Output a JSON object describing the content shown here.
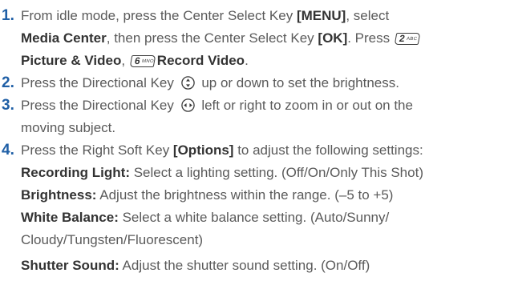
{
  "steps": [
    {
      "number": "1.",
      "lines": [
        {
          "a": "From idle mode, press the Center Select Key ",
          "b": "[MENU]",
          "c": ", select"
        },
        {
          "b1": "Media Center",
          "a": ", then press the Center Select Key ",
          "b2": "[OK]",
          "c": ". Press"
        },
        {
          "b1": "Picture & Video",
          "c": ", ",
          "b2": "Record Video",
          "tail": "."
        }
      ],
      "keys": [
        {
          "digit": "2",
          "letters": "ABC",
          "icon": "key-2-abc-icon"
        },
        {
          "digit": "6",
          "letters": "MNO",
          "icon": "key-6-mno-icon"
        }
      ]
    },
    {
      "number": "2.",
      "a": "Press the Directional Key ",
      "c": " up or down to set the brightness.",
      "icon": "up-down-directional-key-icon"
    },
    {
      "number": "3.",
      "a": "Press the Directional Key ",
      "c": " left or right to zoom in or out on the",
      "line2": "moving subject.",
      "icon": "left-right-directional-key-icon"
    },
    {
      "number": "4.",
      "a": "Press the Right Soft Key ",
      "b": "[Options]",
      "c": " to adjust the following settings:",
      "settings": [
        {
          "label": "Recording Light:",
          "text": " Select a lighting setting. (Off/On/Only This Shot)"
        },
        {
          "label": "Brightness:",
          "text": " Adjust the brightness within the range. (–5 to +5)"
        },
        {
          "label": "White Balance:",
          "text": " Select a white balance setting. (Auto/Sunny/",
          "cont": "Cloudy/Tungsten/Fluorescent)"
        },
        {
          "label": "Shutter Sound:",
          "text": " Adjust the shutter sound setting. (On/Off)"
        }
      ]
    }
  ]
}
